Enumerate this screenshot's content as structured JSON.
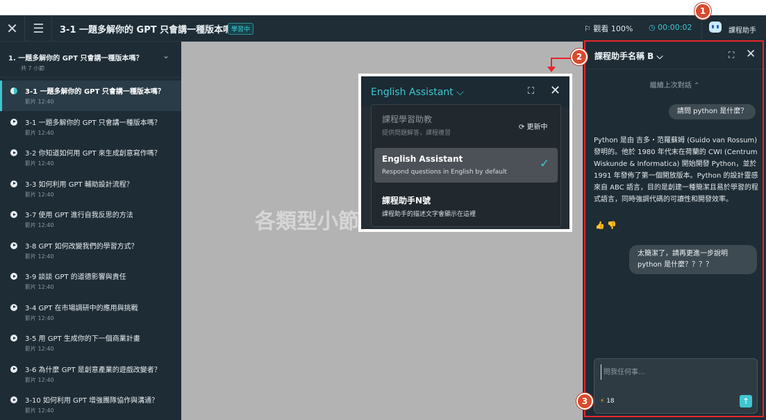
{
  "topbar": {
    "close_icon": "close-icon",
    "list_icon": "list-icon",
    "title": "3-1 一題多解你的 GPT 只會講一種版本嗎？",
    "badge": "學習中",
    "watch_label": "⚐ 觀看 100%",
    "timer": "◷ 00:00:02",
    "assistant_label": "課程助手"
  },
  "sidebar": {
    "chapter_title": "1.   一題多解你的 GPT 只會講一種版本嗎？",
    "chapter_sub": "共 7 小節",
    "lessons": [
      {
        "title": "3-1 一題多解你的 GPT 只會講一種版本嗎？",
        "meta": "影片 12:40"
      },
      {
        "title": "3-1 一題多解你的 GPT 只會講一種版本嗎？",
        "meta": "影片 12:40"
      },
      {
        "title": "3-2 你知道如何用 GPT 來生成創意寫作嗎？",
        "meta": "影片 12:40"
      },
      {
        "title": "3-3 如何利用 GPT 輔助設計流程？",
        "meta": "影片 12:40"
      },
      {
        "title": "3-7 使用 GPT 進行自我反思的方法",
        "meta": "影片 12:40"
      },
      {
        "title": "3-8 GPT 如何改變我們的學習方式？",
        "meta": "影片 12:40"
      },
      {
        "title": "3-9 談談 GPT 的道德影響與責任",
        "meta": "影片 12:40"
      },
      {
        "title": "3-4 GPT 在市場調研中的應用與挑戰",
        "meta": "影片 12:40"
      },
      {
        "title": "3-5 用 GPT 生成你的下一個商業計畫",
        "meta": "影片 12:40"
      },
      {
        "title": "3-6 為什麼 GPT 是創意產業的遊戲改變者？",
        "meta": "影片 12:40"
      },
      {
        "title": "3-10 如何利用 GPT 增強團隊協作與溝通？",
        "meta": "影片 12:40"
      }
    ]
  },
  "video": {
    "watermark": "各類型小節"
  },
  "dropdown": {
    "title": "English Assistant ⌵",
    "options": [
      {
        "name": "課程學習助教",
        "desc": "提供問題解答，課程複習",
        "status": "⟳ 更新中"
      },
      {
        "name": "English Assistant",
        "desc": "Respond questions in English by default"
      },
      {
        "name": "課程助手N號",
        "desc": "課程助手的描述文字會顯示在這裡"
      }
    ]
  },
  "panel": {
    "title": "課程助手名稱 B ⌵",
    "continue_label": "繼續上次對話 ⌃",
    "user_question_1": "請問 python 是什麼？",
    "assistant_answer_1": "Python 是由 吉多・范羅蘇姆 (Guido van Rossum) 發明的。他於 1980 年代末在荷蘭的 CWI (Centrum Wiskunde & Informatica) 開始開發 Python，並於 1991 年發佈了第一個開放版本。Python 的設計靈感來自 ABC 語言，目的是創建一種簡潔且易於學習的程式語言，同時強調代碼的可讀性和開發效率。",
    "feedback_icons": "👍 👎",
    "user_question_2": "太簡潔了，請再更進一步說明 python 是什麼？？？？",
    "input_placeholder": "問我任何事...",
    "credits": "18",
    "send_icon": "arrow-up-icon"
  },
  "markers": [
    "1",
    "2",
    "3"
  ],
  "colors": {
    "accent": "#3fc6d0",
    "annotation_red": "#e8262b",
    "marker": "#d94a2d"
  }
}
